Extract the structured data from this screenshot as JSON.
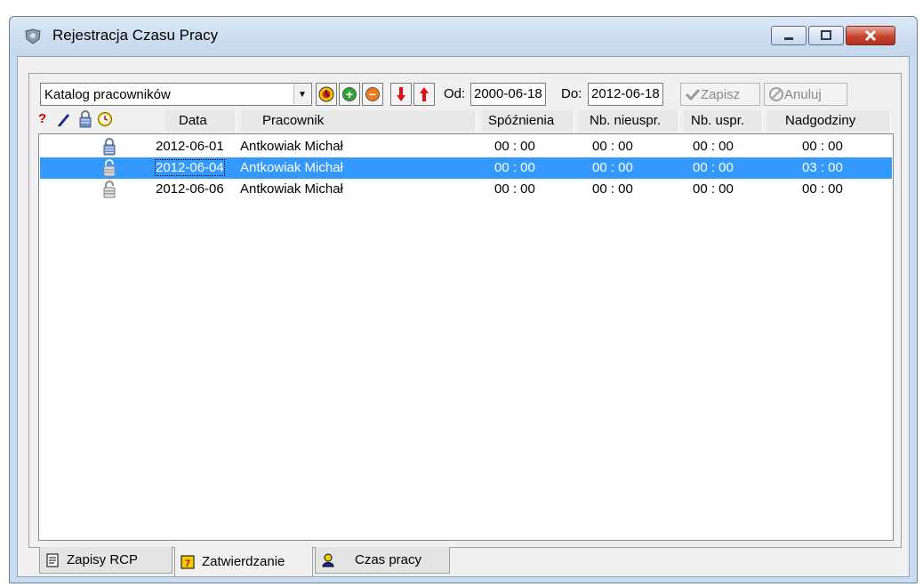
{
  "window": {
    "title": "Rejestracja Czasu Pracy",
    "accent_color": "#3399ff",
    "close_color": "#c7432c"
  },
  "toolbar": {
    "catalog_select": "Katalog pracowników",
    "icons": [
      "clock-report-icon",
      "add-icon",
      "remove-icon",
      "arrow-down-icon",
      "arrow-up-icon"
    ],
    "from_label": "Od:",
    "from_value": "2000-06-18",
    "to_label": "Do:",
    "to_value": "2012-06-18",
    "save_label": "Zapisz",
    "cancel_label": "Anuluj"
  },
  "columns": {
    "data": "Data",
    "pracownik": "Pracownik",
    "spoznienia": "Spóźnienia",
    "nb_nieuspr": "Nb. nieuspr.",
    "nb_uspr": "Nb. uspr.",
    "nadgodziny": "Nadgodziny"
  },
  "rows": [
    {
      "lock": "locked",
      "date": "2012-06-01",
      "employee": "Antkowiak Michał",
      "spoznienia": "00 : 00",
      "nb_nieuspr": "00 : 00",
      "nb_uspr": "00 : 00",
      "nadgodziny": "00 : 00",
      "selected": false
    },
    {
      "lock": "unlocked",
      "date": "2012-06-04",
      "employee": "Antkowiak Michał",
      "spoznienia": "00 : 00",
      "nb_nieuspr": "00 : 00",
      "nb_uspr": "00 : 00",
      "nadgodziny": "03 : 00",
      "selected": true
    },
    {
      "lock": "unlocked",
      "date": "2012-06-06",
      "employee": "Antkowiak Michał",
      "spoznienia": "00 : 00",
      "nb_nieuspr": "00 : 00",
      "nb_uspr": "00 : 00",
      "nadgodziny": "00 : 00",
      "selected": false
    }
  ],
  "tabs": [
    {
      "label": "Zapisy RCP",
      "icon": "document-icon",
      "active": false
    },
    {
      "label": "Zatwierdzanie",
      "icon": "calendar-icon",
      "active": true
    },
    {
      "label": "Czas pracy",
      "icon": "person-icon",
      "active": false
    }
  ]
}
